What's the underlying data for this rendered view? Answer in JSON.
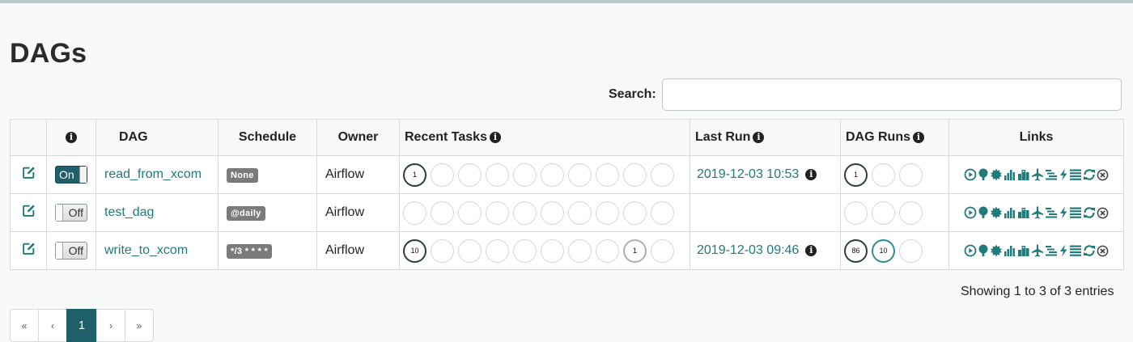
{
  "page": {
    "title": "DAGs"
  },
  "search": {
    "label": "Search:",
    "value": "",
    "placeholder": ""
  },
  "table": {
    "headers": {
      "edit": "",
      "info": "i",
      "dag": "DAG",
      "schedule": "Schedule",
      "owner": "Owner",
      "recent_tasks": "Recent Tasks",
      "last_run": "Last Run",
      "dag_runs": "DAG Runs",
      "links": "Links"
    },
    "rows": [
      {
        "toggle": "On",
        "dag": "read_from_xcom",
        "schedule": "None",
        "owner": "Airflow",
        "recent_tasks": [
          "1",
          "",
          "",
          "",
          "",
          "",
          "",
          "",
          "",
          ""
        ],
        "last_run": "2019-12-03 10:53",
        "dag_runs": [
          "1",
          "",
          ""
        ]
      },
      {
        "toggle": "Off",
        "dag": "test_dag",
        "schedule": "@daily",
        "owner": "Airflow",
        "recent_tasks": [
          "",
          "",
          "",
          "",
          "",
          "",
          "",
          "",
          "",
          ""
        ],
        "last_run": "",
        "dag_runs": [
          "",
          "",
          ""
        ]
      },
      {
        "toggle": "Off",
        "dag": "write_to_xcom",
        "schedule": "*/3 * * * *",
        "owner": "Airflow",
        "recent_tasks": [
          "10",
          "",
          "",
          "",
          "",
          "",
          "",
          "",
          "1",
          ""
        ],
        "last_run": "2019-12-03 09:46",
        "dag_runs": [
          "86",
          "10",
          ""
        ]
      }
    ],
    "link_icons": [
      "trigger-dag-icon",
      "tree-view-icon",
      "graph-view-icon",
      "tasks-duration-icon",
      "task-tries-icon",
      "landing-times-icon",
      "gantt-icon",
      "code-view-icon",
      "logs-icon",
      "refresh-icon",
      "delete-icon"
    ]
  },
  "footer": {
    "info": "Showing 1 to 3 of 3 entries"
  },
  "pagination": {
    "first": "«",
    "prev": "‹",
    "current": "1",
    "next": "›",
    "last": "»"
  },
  "colors": {
    "accent": "#217a7b",
    "toggle_on": "#1f5f69",
    "badge": "#7b7b7b"
  }
}
